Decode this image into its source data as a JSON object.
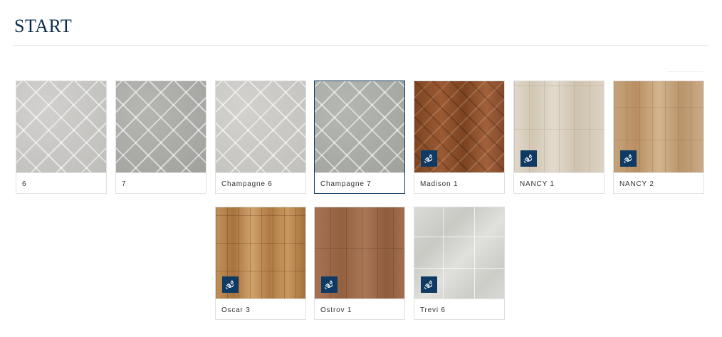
{
  "page": {
    "title": "START"
  },
  "products": [
    {
      "label": "6",
      "texture": "tile-diamond tile-light",
      "badge": false,
      "selected": false
    },
    {
      "label": "7",
      "texture": "tile-diamond tile-mid",
      "badge": false,
      "selected": false
    },
    {
      "label": "Champagne 6",
      "texture": "tile-diamond tile-lighter",
      "badge": false,
      "selected": false
    },
    {
      "label": "Champagne 7",
      "texture": "tile-diamond tile-green",
      "badge": false,
      "selected": true
    },
    {
      "label": "Madison 1",
      "texture": "herringbone",
      "badge": true,
      "selected": false
    },
    {
      "label": "NANCY 1",
      "texture": "wood-pale",
      "badge": true,
      "selected": false
    },
    {
      "label": "NANCY 2",
      "texture": "wood-tan",
      "badge": true,
      "selected": false
    },
    {
      "label": "Oscar 3",
      "texture": "wood-oscar",
      "badge": true,
      "selected": false
    },
    {
      "label": "Ostrov 1",
      "texture": "wood-ostrov",
      "badge": true,
      "selected": false
    },
    {
      "label": "Trevi 6",
      "texture": "tile-trevi",
      "badge": true,
      "selected": false
    }
  ],
  "icons": {
    "badge": "hand-drop-icon"
  },
  "colors": {
    "brand": "#0f3a63",
    "title": "#0b2e4f",
    "border": "#e0e0e0"
  }
}
